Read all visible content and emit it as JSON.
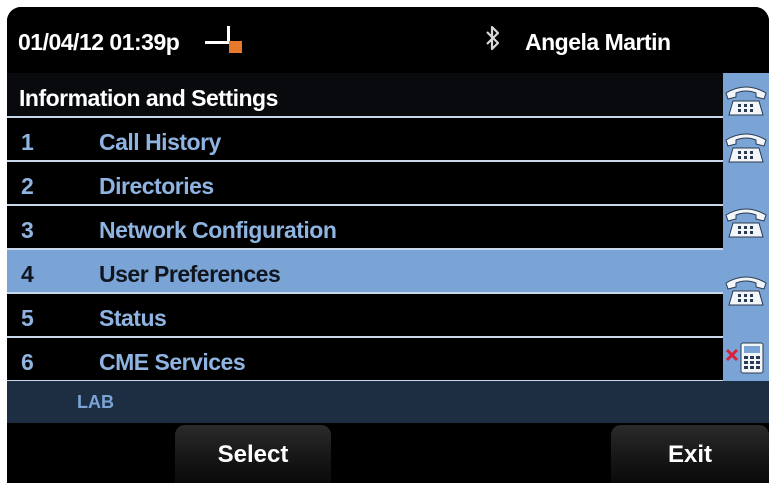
{
  "header": {
    "datetime": "01/04/12 01:39p",
    "user_name": "Angela Martin",
    "icons": [
      "offhook-handset-icon",
      "bluetooth-icon"
    ]
  },
  "menu": {
    "title": "Information and Settings",
    "items": [
      {
        "number": "1",
        "label": "Call History"
      },
      {
        "number": "2",
        "label": "Directories"
      },
      {
        "number": "3",
        "label": "Network Configuration"
      },
      {
        "number": "4",
        "label": "User Preferences",
        "selected": true
      },
      {
        "number": "5",
        "label": "Status"
      },
      {
        "number": "6",
        "label": "CME Services"
      }
    ]
  },
  "line_keys": [
    "phone-line-icon",
    "phone-line-icon",
    "phone-line-icon",
    "phone-line-icon",
    "speed-dial-unavailable-icon"
  ],
  "status_strip": {
    "text": "LAB"
  },
  "softkeys": {
    "select": "Select",
    "exit": "Exit"
  },
  "colors": {
    "selected_row": "#7ba4d6",
    "item_text": "#8fb4e2",
    "status_bar": "#1d2d42",
    "handset_accent": "#e8782a"
  }
}
